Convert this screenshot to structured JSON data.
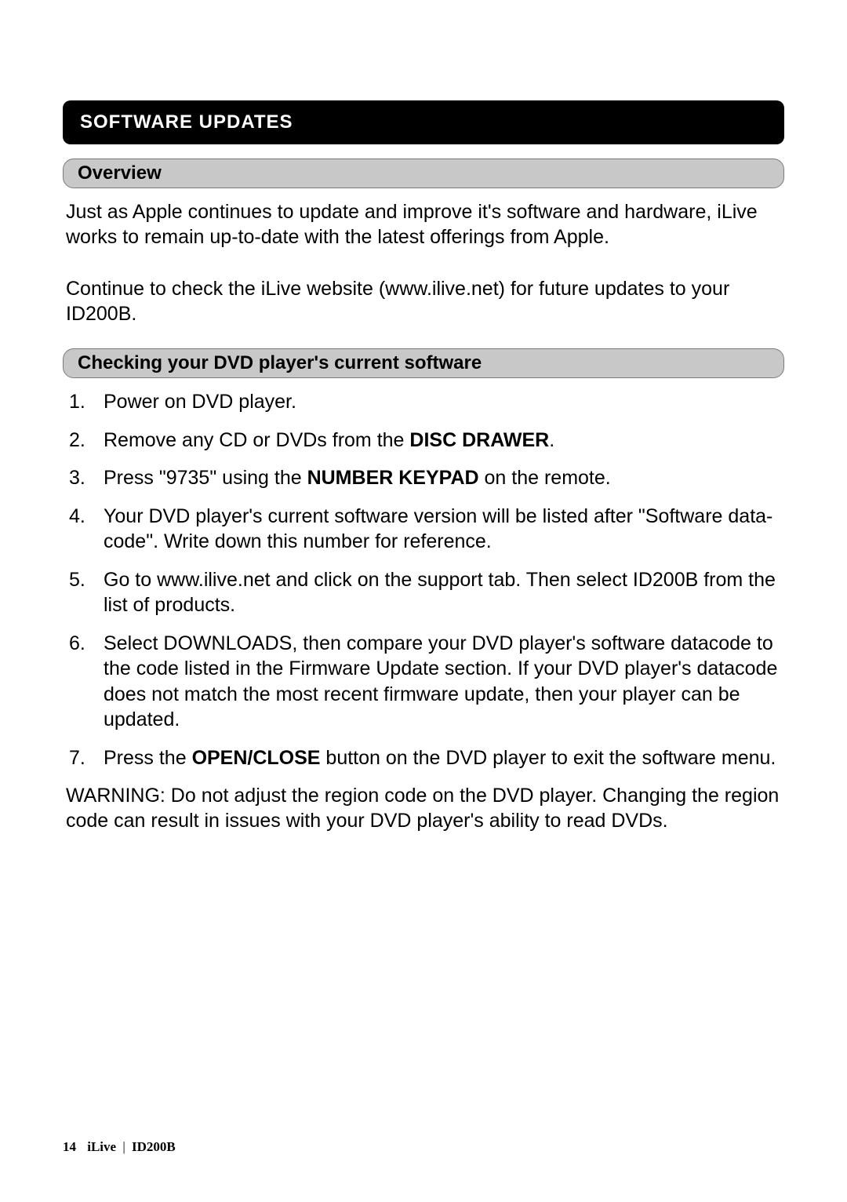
{
  "section": {
    "title": "SOFTWARE UPDATES"
  },
  "overview": {
    "heading": "Overview",
    "para1": "Just as Apple continues to update and improve it's software and hardware, iLive works to remain up-to-date with the latest offerings from Apple.",
    "para2": "Continue to check the iLive website (www.ilive.net) for future updates to your ID200B."
  },
  "checking": {
    "heading": "Checking your DVD player's current software",
    "steps": {
      "s1": "Power on DVD player.",
      "s2a": "Remove any CD or DVDs from the ",
      "s2b": "DISC DRAWER",
      "s2c": ".",
      "s3a": "Press \"9735\" using the ",
      "s3b": "NUMBER KEYPAD",
      "s3c": " on the remote.",
      "s4": "Your DVD  player's current software version will be listed after \"Software data-code\". Write down this number for reference.",
      "s5": "Go to www.ilive.net  and click on the support tab.  Then select ID200B from the list of products.",
      "s6": "Select DOWNLOADS, then compare your DVD player's software datacode to the code listed in the Firmware Update section. If your DVD player's datacode does not match the most recent firmware update, then your player can be updated.",
      "s7a": "Press the ",
      "s7b": "OPEN/CLOSE",
      "s7c": " button on the DVD player to exit the software menu."
    },
    "warning": "WARNING: Do not adjust the region code on the DVD player. Changing the region code can result in issues with your DVD player's ability to read DVDs."
  },
  "footer": {
    "page": "14",
    "brand": "iLive",
    "sep": "|",
    "model": "ID200B"
  }
}
